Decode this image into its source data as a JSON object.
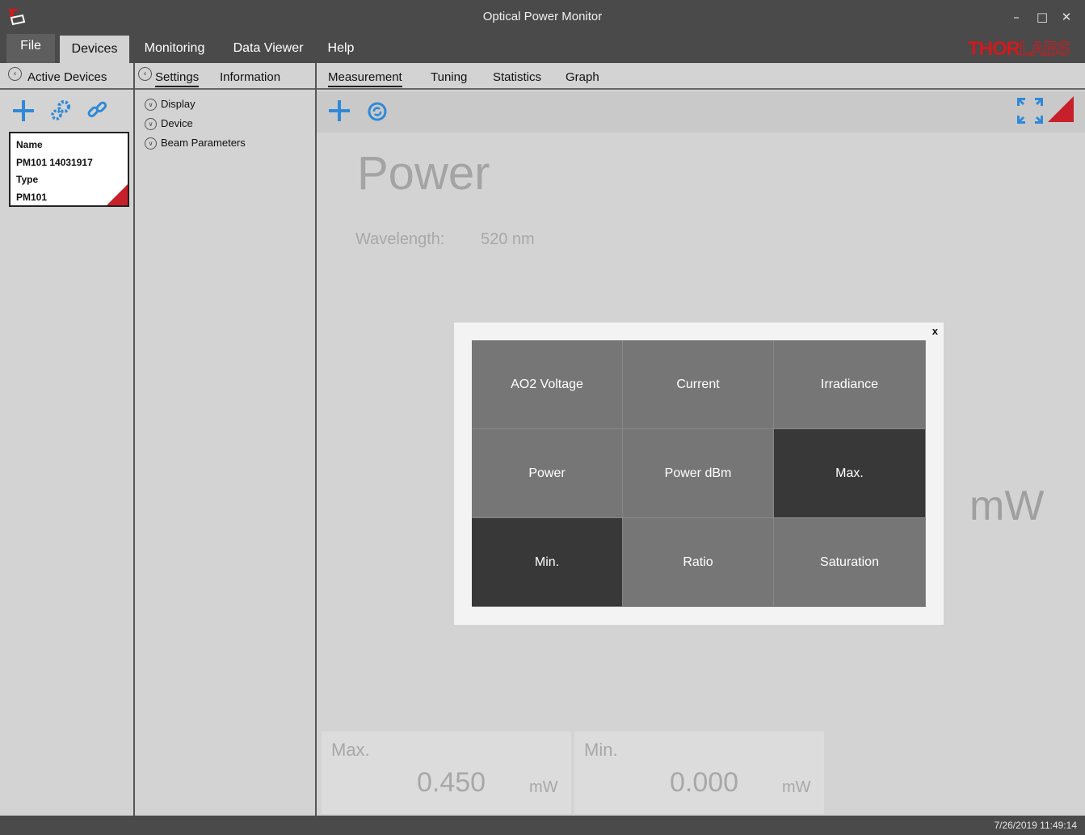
{
  "window": {
    "title": "Optical Power Monitor"
  },
  "menu": {
    "file": "File",
    "devices": "Devices",
    "monitoring": "Monitoring",
    "data_viewer": "Data Viewer",
    "help": "Help"
  },
  "brand": {
    "logo_part1": "THOR",
    "logo_part2": "LABS",
    "accent": "#c8202a"
  },
  "active_devices": {
    "header": "Active Devices",
    "card": {
      "name_label": "Name",
      "name_value": "PM101 14031917",
      "type_label": "Type",
      "type_value": "PM101"
    }
  },
  "settings_panel": {
    "tabs": [
      "Settings",
      "Information"
    ],
    "items": [
      "Display",
      "Device",
      "Beam Parameters"
    ]
  },
  "main": {
    "tabs": [
      "Measurement",
      "Tuning",
      "Statistics",
      "Graph"
    ],
    "title": "Power",
    "wavelength_label": "Wavelength:",
    "wavelength_value": "520 nm",
    "unit": "mW",
    "max": {
      "label": "Max.",
      "value": "0.450",
      "unit": "mW"
    },
    "min": {
      "label": "Min.",
      "value": "0.000",
      "unit": "mW"
    }
  },
  "modal": {
    "close": "x",
    "options": [
      {
        "label": "AO2 Voltage",
        "selected": false
      },
      {
        "label": "Current",
        "selected": false
      },
      {
        "label": "Irradiance",
        "selected": false
      },
      {
        "label": "Power",
        "selected": false
      },
      {
        "label": "Power dBm",
        "selected": false
      },
      {
        "label": "Max.",
        "selected": true
      },
      {
        "label": "Min.",
        "selected": true
      },
      {
        "label": "Ratio",
        "selected": false
      },
      {
        "label": "Saturation",
        "selected": false
      }
    ]
  },
  "status": {
    "timestamp": "7/26/2019 11:49:14"
  }
}
